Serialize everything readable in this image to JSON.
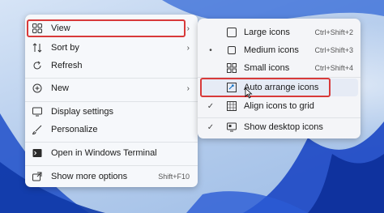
{
  "context_menu": {
    "items": [
      {
        "label": "View",
        "icon": "grid-icon",
        "submenu": true
      },
      {
        "label": "Sort by",
        "icon": "sort-icon",
        "submenu": true
      },
      {
        "label": "Refresh",
        "icon": "refresh-icon"
      },
      {
        "label": "New",
        "icon": "plus-circle-icon",
        "submenu": true
      },
      {
        "label": "Display settings",
        "icon": "display-icon"
      },
      {
        "label": "Personalize",
        "icon": "brush-icon"
      },
      {
        "label": "Open in Windows Terminal",
        "icon": "terminal-icon"
      },
      {
        "label": "Show more options",
        "icon": "share-icon",
        "shortcut": "Shift+F10"
      }
    ]
  },
  "view_submenu": {
    "items": [
      {
        "label": "Large icons",
        "icon": "large-icons-icon",
        "shortcut": "Ctrl+Shift+2",
        "mark": ""
      },
      {
        "label": "Medium icons",
        "icon": "medium-icons-icon",
        "shortcut": "Ctrl+Shift+3",
        "mark": "•"
      },
      {
        "label": "Small icons",
        "icon": "small-icons-icon",
        "shortcut": "Ctrl+Shift+4",
        "mark": ""
      },
      {
        "label": "Auto arrange icons",
        "icon": "auto-arrange-icon",
        "mark": ""
      },
      {
        "label": "Align icons to grid",
        "icon": "align-grid-icon",
        "mark": "✓"
      },
      {
        "label": "Show desktop icons",
        "icon": "desktop-icons-icon",
        "mark": "✓"
      }
    ]
  },
  "colors": {
    "highlight_border": "#d83a3a",
    "menu_bg": "#f6f8fb",
    "accent": "#0067c0"
  }
}
